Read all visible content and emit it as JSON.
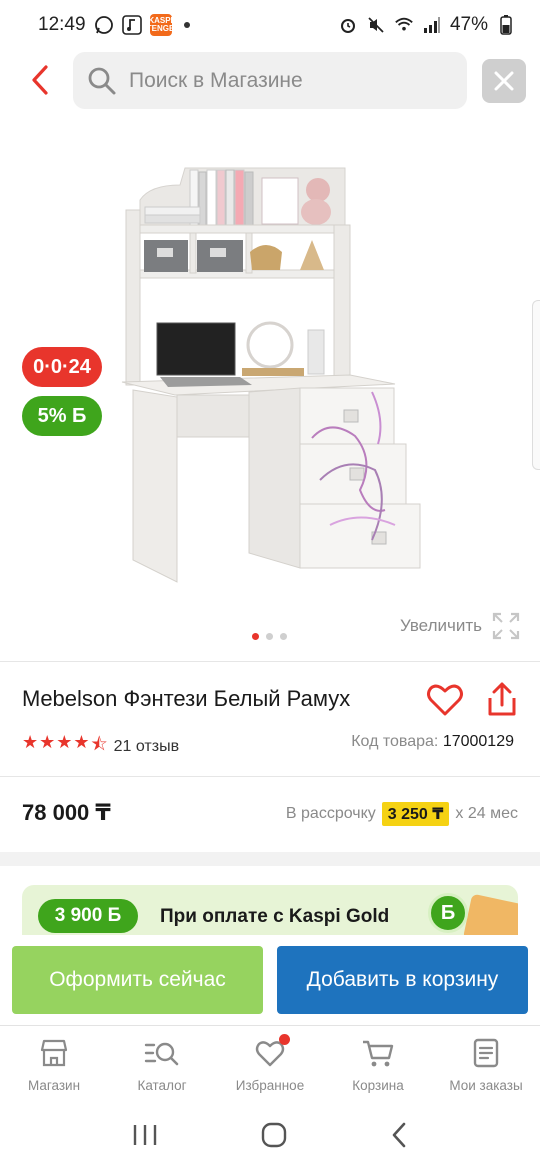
{
  "status_bar": {
    "time": "12:49",
    "battery": "47%",
    "kaspi_mini": "KASPI TENGE"
  },
  "search": {
    "placeholder": "Поиск в Магазине"
  },
  "badges": {
    "installment": "0·0·24",
    "bonus": "5% Б"
  },
  "gallery": {
    "zoom_label": "Увеличить",
    "slide_count": 3,
    "active_slide": 1
  },
  "product": {
    "title": "Mebelson Фэнтези Белый Рамух",
    "rating_stars": 4.5,
    "reviews": "21 отзыв",
    "sku_label": "Код товара:",
    "sku_value": "17000129",
    "price": "78 000 ₸",
    "installment_label": "В рассрочку",
    "installment_amount": "3 250 ₸",
    "installment_term": "x 24 мес"
  },
  "kaspi_gold": {
    "bonus": "3 900 Б",
    "text": "При оплате с Kaspi Gold",
    "coin": "Б"
  },
  "actions": {
    "order": "Оформить сейчас",
    "add_to_cart": "Добавить в корзину"
  },
  "bottom_nav": {
    "shop": "Магазин",
    "catalog": "Каталог",
    "favorites": "Избранное",
    "cart": "Корзина",
    "orders": "Мои заказы"
  },
  "colors": {
    "accent_red": "#e8352c",
    "accent_green": "#3fa51c",
    "order_button": "#96d35f",
    "cart_button": "#1e73be",
    "installment_highlight": "#f5d213"
  }
}
